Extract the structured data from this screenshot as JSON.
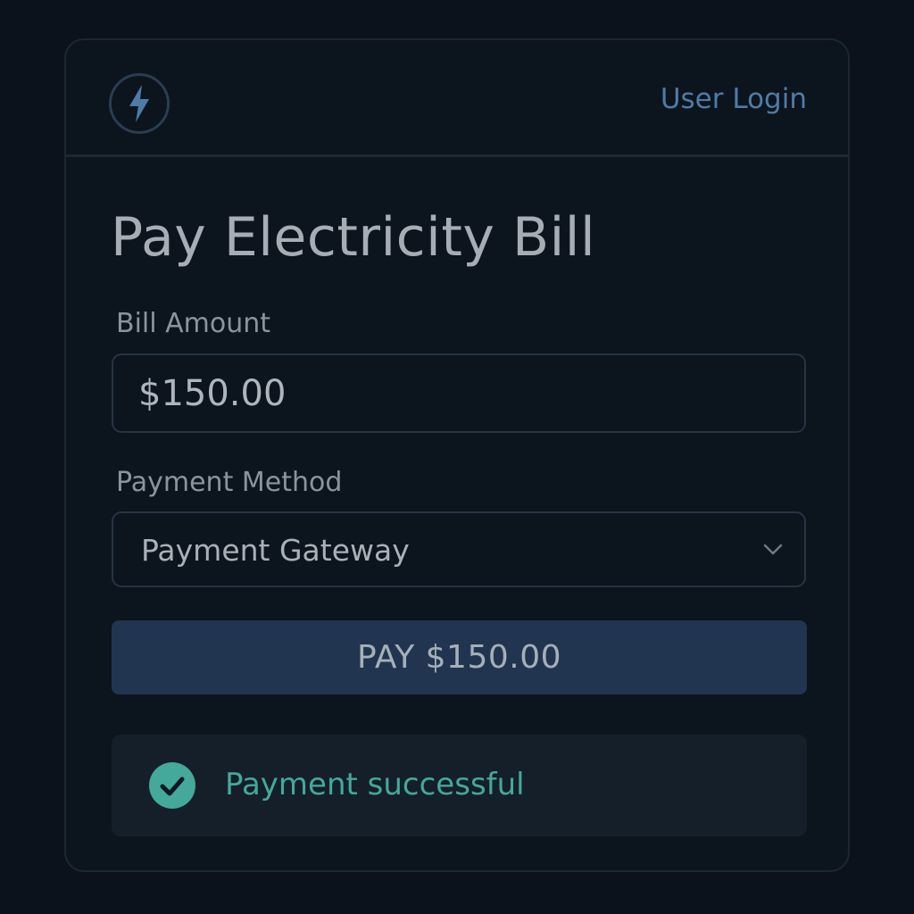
{
  "header": {
    "logo_icon": "lightning-bolt-icon",
    "login_label": "User Login"
  },
  "main": {
    "title": "Pay Electricity Bill",
    "amount": {
      "label": "Bill Amount",
      "value": "$150.00"
    },
    "payment_method": {
      "label": "Payment Method",
      "selected": "Payment Gateway",
      "icon": "chevron-down-icon"
    },
    "pay_button_label": "PAY $150.00",
    "status": {
      "icon": "check-circle-icon",
      "message": "Payment successful"
    }
  },
  "colors": {
    "background": "#0b121b",
    "accent": "#4f7ca6",
    "button": "#213550",
    "success": "#44a89a"
  }
}
